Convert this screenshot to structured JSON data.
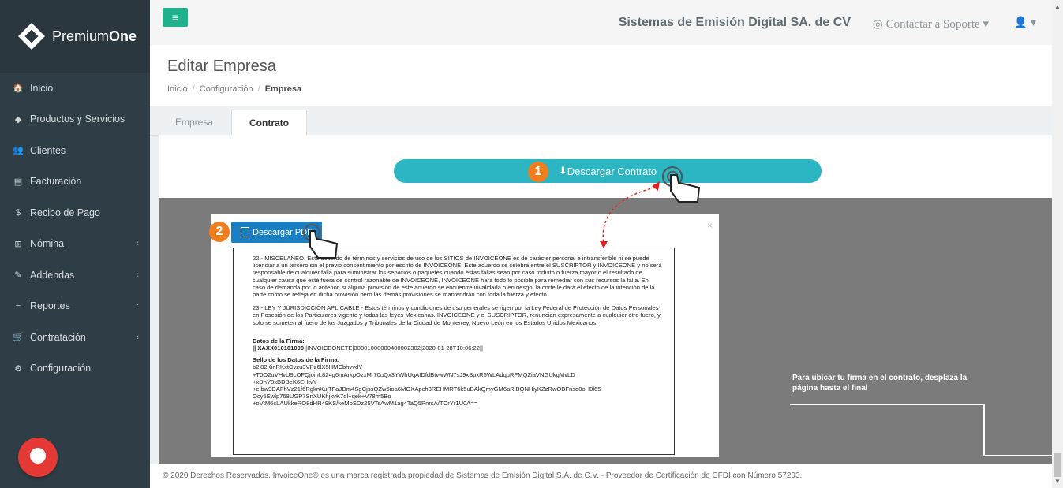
{
  "brand": {
    "name_light": "Premium",
    "name_bold": "One"
  },
  "sidebar": {
    "items": [
      {
        "label": "Inicio",
        "icon": "home-icon",
        "glyph": "🏠",
        "chevron": false
      },
      {
        "label": "Productos y Servicios",
        "icon": "tag-icon",
        "glyph": "◆",
        "chevron": false
      },
      {
        "label": "Clientes",
        "icon": "users-icon",
        "glyph": "👥",
        "chevron": false
      },
      {
        "label": "Facturación",
        "icon": "document-icon",
        "glyph": "▤",
        "chevron": false
      },
      {
        "label": "Recibo de Pago",
        "icon": "dollar-icon",
        "glyph": "$",
        "chevron": false
      },
      {
        "label": "Nómina",
        "icon": "sitemap-icon",
        "glyph": "⊞",
        "chevron": true
      },
      {
        "label": "Addendas",
        "icon": "paperclip-icon",
        "glyph": "✎",
        "chevron": true
      },
      {
        "label": "Reportes",
        "icon": "list-icon",
        "glyph": "≡",
        "chevron": true
      },
      {
        "label": "Contratación",
        "icon": "cart-icon",
        "glyph": "🛒",
        "chevron": true
      },
      {
        "label": "Configuración",
        "icon": "gears-icon",
        "glyph": "⚙",
        "chevron": false
      }
    ]
  },
  "topbar": {
    "company": "Sistemas de Emisión Digital SA. de CV",
    "support": "Contactar a Soporte",
    "support_icon": "lifebuoy-icon",
    "user_icon": "user-icon"
  },
  "page": {
    "title": "Editar Empresa",
    "breadcrumb": [
      "Inicio",
      "Configuración",
      "Empresa"
    ]
  },
  "tabs": [
    {
      "label": "Empresa",
      "active": false
    },
    {
      "label": "Contrato",
      "active": true
    }
  ],
  "download_contract_label": "Descargar Contrato",
  "modal": {
    "download_pdf_label": "Descargar PDF",
    "doc": {
      "para1": "22 - MISCELANEO. Este acuerdo de términos y servicios de uso de los SITIOS de INVOICEONE es de carácter personal e intransferible ni se puede licenciar a un tercero sin el previo consentimiento por escrito de INVOICEONE. Este acuerdo se celebra entre el SUSCRIPTOR y INVOICEONE y no será responsable de cualquier falla para suministrar los servicios o paquetes cuando éstas fallas sean por caso fortuito o fuerza mayor o el resultado de cualquier causa que esté fuera de control razonable de INVOICEONE, INVOICEONE hará todo lo posible para remediar con sus recursos la falla. En caso de demanda por lo anterior, si alguna provisión de este acuerdo se encuentre invalidada o en riesgo, la corte le dará el efecto de la intención de la parte como se refleja en dicha provisión pero las demás provisiones se mantendrán con toda la fuerza y efecto.",
      "para2": "23 - LEY Y JURISDICCIÓN APLICABLE - Estos términos y condiciones de uso generales se rigen por la Ley Federal de Protección de Datos Personales en Posesión de los Particulares vigente y todas las leyes Mexicanas. INVOICEONE y el SUSCRIPTOR, renuncian expresamente a cualquier otro fuero, y solo se someten al fuero de los Juzgados y Tribunales de la Ciudad de Monterrey, Nuevo León en los Estados Unidos Mexicanos.",
      "firma_label": "Datos de la Firma:",
      "firma_rfc": "|| XAXX010101000",
      "firma_value": " |INVOICEONETE|30001000000400002302|2020-01-28T10:06:22||",
      "sello_label": "Sello de los Datos de la Firma:",
      "sello_lines": [
        "b2l82KinRKxtCvzu3VPz6lX5HMCbhvvdY",
        "+T0O2uVHvU9cOFQjoihL824g6mArkpOzxMr70uQx3YWhUqAIDfdBtvwWN7sJ9xSpxR5WLAdquRFMQZiaVNGUkgMvLD",
        "+xDnY8xBDBeK6EHtvY",
        "+eibw9DAFhVz21f6RgknXujTFaJDm4SgCjssQZw6ioa6MOXApch3REHMRT6k5uBAkQmyGM6aRiBQNHiyKZzRwOBFnsd0oH0l65",
        "Ocy5Ewlp768UGP7SnXUKhjkvK7ql+qek+V78m5Bo",
        "+oVtM6cLAUkkeRO8dHR49KS/keMoSDz25VTsAwM1ag4TaQ5PnrsA/TOrYr1U0A=="
      ]
    }
  },
  "hint_text": "Para ubicar tu firma en el contrato, desplaza la página hasta el final",
  "steps": [
    "1",
    "2"
  ],
  "footer": "© 2020 Derechos Reservados. InvoiceOne® es una marca registrada propiedad de Sistemas de Emisión Digital S.A. de C.V. - Proveedor de Certificación de CFDI con Número 57203.",
  "colors": {
    "sidebar": "#2f3e46",
    "accent": "#1fb28c",
    "download": "#2cb5c3",
    "pdf_button": "#1a7ec2",
    "step": "#f07d1e",
    "arrow": "#e02020"
  }
}
